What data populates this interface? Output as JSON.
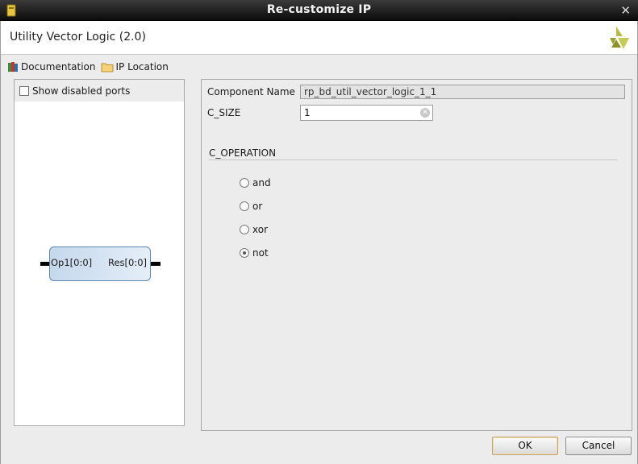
{
  "window": {
    "title": "Re-customize IP",
    "close_glyph": "✕"
  },
  "header": {
    "ip_name": "Utility Vector Logic (2.0)",
    "logo_icon": "xilinx-logo-icon"
  },
  "links": [
    {
      "label": "Documentation",
      "icon": "book-icon"
    },
    {
      "label": "IP Location",
      "icon": "folder-icon"
    }
  ],
  "preview": {
    "show_disabled_ports_label": "Show disabled ports",
    "show_disabled_ports_checked": false,
    "block": {
      "input_port": "Op1[0:0]",
      "output_port": "Res[0:0]"
    }
  },
  "config": {
    "component_name": {
      "label": "Component Name",
      "value": "rp_bd_util_vector_logic_1_1"
    },
    "c_size": {
      "label": "C_SIZE",
      "value": "1"
    },
    "c_operation": {
      "label": "C_OPERATION",
      "options": [
        "and",
        "or",
        "xor",
        "not"
      ],
      "selected": "not"
    }
  },
  "buttons": {
    "ok": "OK",
    "cancel": "Cancel"
  },
  "colors": {
    "titlebar": "#1a1a1a",
    "block_fill": "#d3e2f2",
    "ok_border": "#c4a36a",
    "logo": "#a9b23a"
  }
}
